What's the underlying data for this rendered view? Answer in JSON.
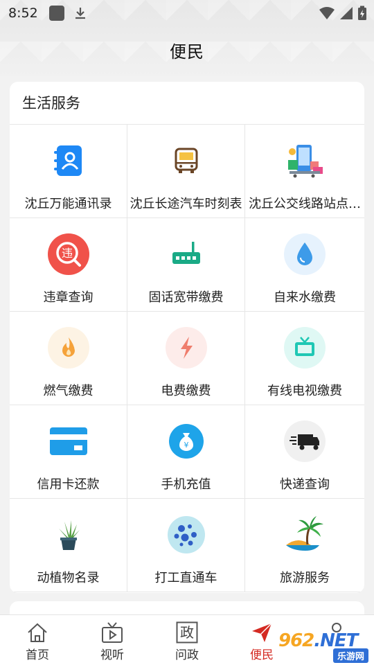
{
  "status_bar": {
    "time": "8:52"
  },
  "header": {
    "title": "便民"
  },
  "section": {
    "title": "生活服务",
    "items": [
      {
        "label": "沈丘万能通讯录",
        "icon": "contacts-book-icon",
        "color": "#1e88f5"
      },
      {
        "label": "沈丘长途汽车时刻表",
        "icon": "bus-icon",
        "color": "#8a5a2b"
      },
      {
        "label": "沈丘公交线路站点…",
        "icon": "shopping-phone-icon",
        "color": "#3a8ee6"
      },
      {
        "label": "违章查询",
        "icon": "violation-search-icon",
        "color": "#f0524a"
      },
      {
        "label": "固话宽带缴费",
        "icon": "router-icon",
        "color": "#1aaa86"
      },
      {
        "label": "自来水缴费",
        "icon": "water-drop-icon",
        "color": "#3d9be9"
      },
      {
        "label": "燃气缴费",
        "icon": "flame-icon",
        "color": "#f5a23a"
      },
      {
        "label": "电费缴费",
        "icon": "lightning-icon",
        "color": "#ef7d6c"
      },
      {
        "label": "有线电视缴费",
        "icon": "tv-icon",
        "color": "#1fc7b4"
      },
      {
        "label": "信用卡还款",
        "icon": "credit-card-icon",
        "color": "#1f9de8"
      },
      {
        "label": "手机充值",
        "icon": "money-bag-icon",
        "color": "#1ea4e9"
      },
      {
        "label": "快递查询",
        "icon": "delivery-truck-icon",
        "color": "#222222"
      },
      {
        "label": "动植物名录",
        "icon": "potted-plant-icon",
        "color": "#3f8f3a"
      },
      {
        "label": "打工直通车",
        "icon": "bubbles-icon",
        "color": "#2f5fc6"
      },
      {
        "label": "旅游服务",
        "icon": "palm-island-icon",
        "color": "#f0a830"
      }
    ]
  },
  "tabs": [
    {
      "label": "首页",
      "icon": "home-icon",
      "active": false
    },
    {
      "label": "视听",
      "icon": "tv-play-icon",
      "active": false
    },
    {
      "label": "问政",
      "icon": "zheng-icon",
      "active": false
    },
    {
      "label": "便民",
      "icon": "paper-plane-icon",
      "active": true
    },
    {
      "label": "",
      "icon": "profile-icon",
      "active": false
    }
  ],
  "tab_glyphs": {
    "zheng": "政"
  },
  "watermark": {
    "main": "962",
    "net": ".NET",
    "sub": "乐游网"
  },
  "colors": {
    "accent": "#d42a22",
    "background": "#f2f2f2"
  }
}
